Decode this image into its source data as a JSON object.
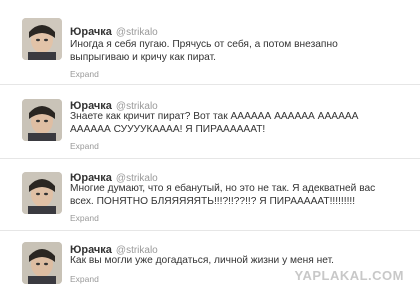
{
  "tweets": [
    {
      "name": "Юрачка",
      "handle": "@strikalo",
      "lines": [
        "Иногда я себя пугаю. Прячусь от себя, а потом внезапно",
        "выпрыгиваю и кричу как пират."
      ],
      "expand": "Expand"
    },
    {
      "name": "Юрачка",
      "handle": "@strikalo",
      "lines": [
        "Знаете как кричит пират? Вот так АААААА АААААА АААААА",
        "АААААА СУУУУКАААА! Я ПИРААААААТ!"
      ],
      "expand": "Expand"
    },
    {
      "name": "Юрачка",
      "handle": "@strikalo",
      "lines": [
        "Многие думают, что я ебанутый, но это не так. Я адекватней вас",
        "всех. ПОНЯТНО БЛЯЯЯЯЯТЬ!!!?!!??!!? Я ПИРАААААТ!!!!!!!!!"
      ],
      "expand": "Expand"
    },
    {
      "name": "Юрачка",
      "handle": "@strikalo",
      "lines": [
        "Как вы могли уже догадаться, личной жизни у меня нет."
      ],
      "expand": "Expand"
    }
  ],
  "watermark": "YAPLAKAL.COM"
}
